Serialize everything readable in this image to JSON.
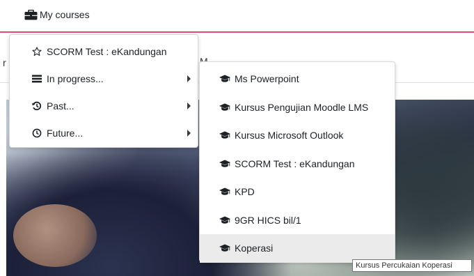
{
  "nav": {
    "my_courses_label": "My courses",
    "strip_left_char": "r",
    "strip_mid_char": "M"
  },
  "primary_menu": {
    "items": [
      {
        "label": "SCORM Test : eKandungan",
        "icon": "star-outline-icon",
        "has_submenu": false
      },
      {
        "label": "In progress...",
        "icon": "list-icon",
        "has_submenu": true
      },
      {
        "label": "Past...",
        "icon": "history-icon",
        "has_submenu": true
      },
      {
        "label": "Future...",
        "icon": "clock-icon",
        "has_submenu": true
      }
    ]
  },
  "submenu": {
    "items": [
      {
        "label": "Ms Powerpoint",
        "icon": "graduation-cap-icon"
      },
      {
        "label": "Kursus Pengujian Moodle LMS",
        "icon": "graduation-cap-icon"
      },
      {
        "label": "Kursus Microsoft Outlook",
        "icon": "graduation-cap-icon"
      },
      {
        "label": "SCORM Test : eKandungan",
        "icon": "graduation-cap-icon"
      },
      {
        "label": "KPD",
        "icon": "graduation-cap-icon"
      },
      {
        "label": "9GR HICS bil/1",
        "icon": "graduation-cap-icon"
      },
      {
        "label": "Koperasi",
        "icon": "graduation-cap-icon",
        "highlighted": true
      }
    ]
  },
  "tooltip": {
    "text": "Kursus Percukaian Koperasi"
  },
  "colors": {
    "accent_border": "#e8496c",
    "hover_bg": "#ebebeb",
    "icon_color": "#1d2125"
  }
}
